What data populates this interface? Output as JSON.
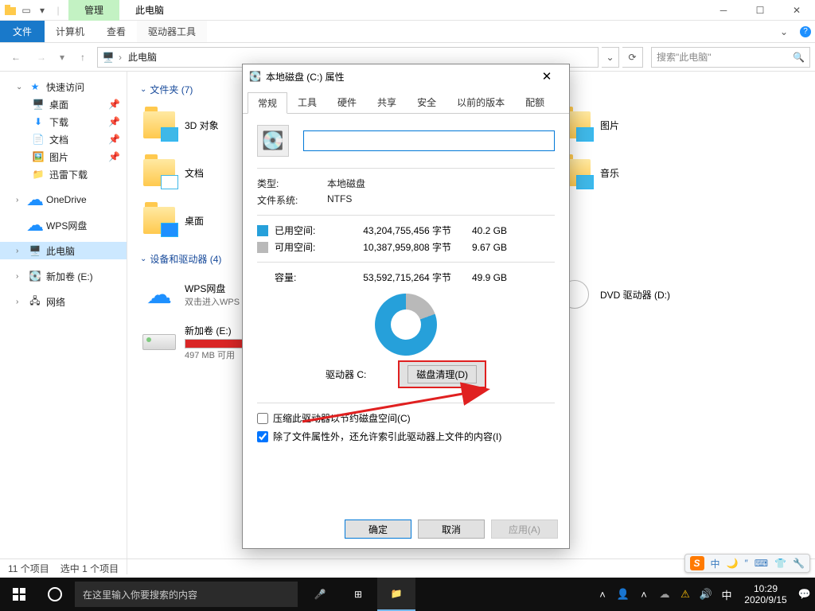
{
  "title_tabs": {
    "manage": "管理",
    "context": "此电脑"
  },
  "ribbon": {
    "file": "文件",
    "computer": "计算机",
    "view": "查看",
    "drive_tools": "驱动器工具"
  },
  "address": {
    "location": "此电脑",
    "search_placeholder": "搜索\"此电脑\""
  },
  "nav": {
    "quick_access": "快速访问",
    "desktop": "桌面",
    "downloads": "下载",
    "documents": "文档",
    "pictures": "图片",
    "xunlei": "迅雷下载",
    "onedrive": "OneDrive",
    "wps": "WPS网盘",
    "this_pc": "此电脑",
    "new_volume": "新加卷 (E:)",
    "network": "网络"
  },
  "sections": {
    "folders": "文件夹 (7)",
    "devices": "设备和驱动器 (4)"
  },
  "folders": {
    "objects3d": "3D 对象",
    "documents": "文档",
    "desktop": "桌面",
    "pictures": "图片",
    "music": "音乐"
  },
  "devices": {
    "wps": {
      "name": "WPS网盘",
      "sub": "双击进入WPS"
    },
    "e": {
      "name": "新加卷 (E:)",
      "sub": "497 MB 可用"
    },
    "dvd": {
      "name": "DVD 驱动器 (D:)"
    }
  },
  "status": {
    "count": "11 个项目",
    "selected": "选中 1 个项目"
  },
  "taskbar": {
    "search": "在这里输入你要搜索的内容",
    "time": "10:29",
    "date": "2020/9/15",
    "ime_lang": "中"
  },
  "dialog": {
    "title": "本地磁盘 (C:) 属性",
    "tabs": {
      "general": "常规",
      "tools": "工具",
      "hardware": "硬件",
      "sharing": "共享",
      "security": "安全",
      "prev": "以前的版本",
      "quota": "配额"
    },
    "type_label": "类型:",
    "type_value": "本地磁盘",
    "fs_label": "文件系统:",
    "fs_value": "NTFS",
    "used_label": "已用空间:",
    "used_bytes": "43,204,755,456 字节",
    "used_gb": "40.2 GB",
    "free_label": "可用空间:",
    "free_bytes": "10,387,959,808 字节",
    "free_gb": "9.67 GB",
    "capacity_label": "容量:",
    "capacity_bytes": "53,592,715,264 字节",
    "capacity_gb": "49.9 GB",
    "drive_label": "驱动器 C:",
    "cleanup": "磁盘清理(D)",
    "compress": "压缩此驱动器以节约磁盘空间(C)",
    "index": "除了文件属性外，还允许索引此驱动器上文件的内容(I)",
    "ok": "确定",
    "cancel": "取消",
    "apply": "应用(A)"
  },
  "ime": {
    "lang": "中"
  }
}
